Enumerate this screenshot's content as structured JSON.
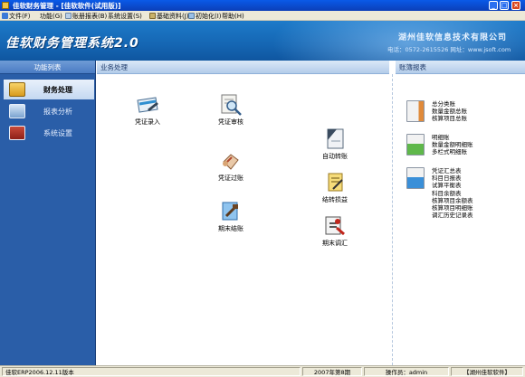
{
  "window": {
    "title": "佳软财务管理 - [佳软软件(试用版)]",
    "min_symbol": "_",
    "max_symbol": "□",
    "close_symbol": "×"
  },
  "menu": [
    {
      "label": "文件(F)",
      "icon": "file-icon"
    },
    {
      "label": "功能(G)"
    },
    {
      "label": "账册报表(B)"
    },
    {
      "label": "系统设置(S)"
    },
    {
      "label": "基础资料(J)"
    },
    {
      "label": "初始化(I)"
    },
    {
      "label": "帮助(H)"
    }
  ],
  "banner": {
    "system_title": "佳软财务管理系统2.0",
    "company": "湖州佳软信息技术有限公司",
    "contact": "电话：0572-2615526  网址：www.jsoft.com"
  },
  "left_panel": {
    "header": "功能列表",
    "items": [
      {
        "label": "财务处理",
        "icon": "finance-icon",
        "active": true
      },
      {
        "label": "报表分析",
        "icon": "report-analysis-icon",
        "active": false
      },
      {
        "label": "系统设置",
        "icon": "settings-icon",
        "active": false
      }
    ]
  },
  "business": {
    "header": "业务处理",
    "tiles": {
      "voucher_entry": "凭证录入",
      "voucher_audit": "凭证审核",
      "voucher_post": "凭证过账",
      "auto_transfer": "自动转账",
      "period_end_close": "期末结账",
      "carry_forward": "结转损益",
      "period_end_adjust": "期末调汇"
    }
  },
  "reports": {
    "header": "账簿报表",
    "groups": [
      {
        "icon": "ledger-book-icon",
        "items": [
          "总分类账",
          "数量金额总账",
          "核算项目总账"
        ]
      },
      {
        "icon": "detail-book-icon",
        "items": [
          "明细账",
          "数量金额明细账",
          "多栏式明细账"
        ]
      },
      {
        "icon": "summary-book-icon",
        "items": [
          "凭证汇总表",
          "科目日报表",
          "试算平衡表",
          "科目余额表",
          "核算项目余额表",
          "核算项目明细账",
          "调汇历史记录表"
        ]
      }
    ]
  },
  "status": {
    "version": "佳软ERP2006.12.11版本",
    "period": "2007年第8期",
    "operator": "操作员：admin",
    "company": "【湖州佳软软件】"
  },
  "colors": {
    "banner": "#1566b3",
    "left_panel": "#2a5ea8",
    "title_bar": "#0b3fb8"
  }
}
